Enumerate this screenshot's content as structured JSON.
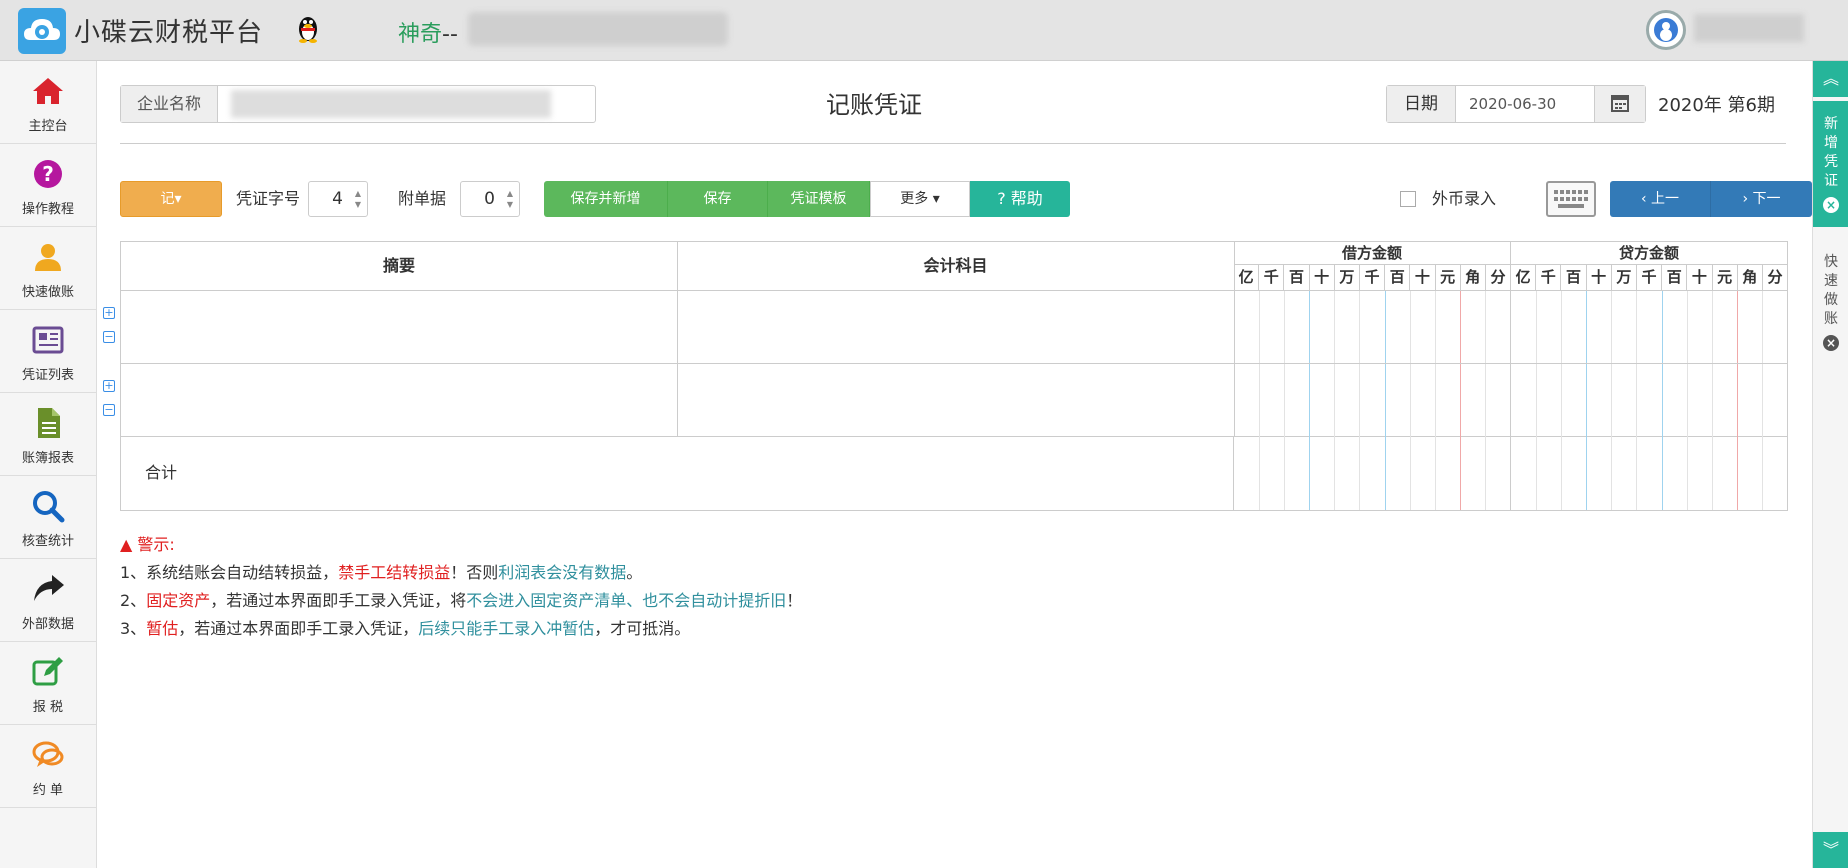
{
  "header": {
    "app_title": "小碟云财税平台",
    "company_prefix": "神奇",
    "company_sep": "--"
  },
  "sidebar": {
    "items": [
      {
        "label": "主控台",
        "icon": "home-icon",
        "color": "#d9232d"
      },
      {
        "label": "操作教程",
        "icon": "question-icon",
        "color": "#b5179e"
      },
      {
        "label": "快速做账",
        "icon": "user-icon",
        "color": "#f0a81f"
      },
      {
        "label": "凭证列表",
        "icon": "newspaper-icon",
        "color": "#6a4c93"
      },
      {
        "label": "账簿报表",
        "icon": "file-icon",
        "color": "#6a8f2a"
      },
      {
        "label": "核查统计",
        "icon": "search-icon",
        "color": "#1565c0"
      },
      {
        "label": "外部数据",
        "icon": "share-icon",
        "color": "#222222"
      },
      {
        "label": "报 税",
        "icon": "edit-icon",
        "color": "#2e9e44"
      },
      {
        "label": "约 单",
        "icon": "chat-icon",
        "color": "#f08a24"
      }
    ]
  },
  "main": {
    "company_label": "企业名称",
    "title": "记账凭证",
    "date_label": "日期",
    "date_value": "2020-06-30",
    "period": "2020年 第6期"
  },
  "toolbar": {
    "ji_label": "记▾",
    "voucher_no_label": "凭证字号",
    "voucher_no": "4",
    "attach_label": "附单据",
    "attach_count": "0",
    "save_new": "保存并新增",
    "save": "保存",
    "template": "凭证模板",
    "more": "更多 ▾",
    "help": "? 帮助",
    "foreign": "外币录入",
    "prev": "‹ 上一",
    "next": "› 下一"
  },
  "table": {
    "col_summary": "摘要",
    "col_account": "会计科目",
    "debit": "借方金额",
    "credit": "贷方金额",
    "digits": [
      "亿",
      "千",
      "百",
      "十",
      "万",
      "千",
      "百",
      "十",
      "元",
      "角",
      "分"
    ],
    "total_label": "合计"
  },
  "notice": {
    "title": "警示:",
    "line1": {
      "a": "1、系统结账会自动结转损益，",
      "b": "禁手工结转损益",
      "c": "！否则",
      "d": "利润表会没有数据",
      "e": "。"
    },
    "line2": {
      "a": "2、",
      "b": "固定资产",
      "c": "，若通过本界面即手工录入凭证，将",
      "d": "不会进入固定资产清单、也不会自动计提折旧",
      "e": "！"
    },
    "line3": {
      "a": "3、",
      "b": "暂估",
      "c": "，若通过本界面即手工录入凭证，",
      "d": "后续只能手工录入冲暂估",
      "e": "，才可抵消。"
    }
  },
  "rightbar": {
    "new_voucher": [
      "新",
      "增",
      "凭",
      "证"
    ],
    "quick": [
      "快",
      "速",
      "做",
      "账"
    ]
  }
}
